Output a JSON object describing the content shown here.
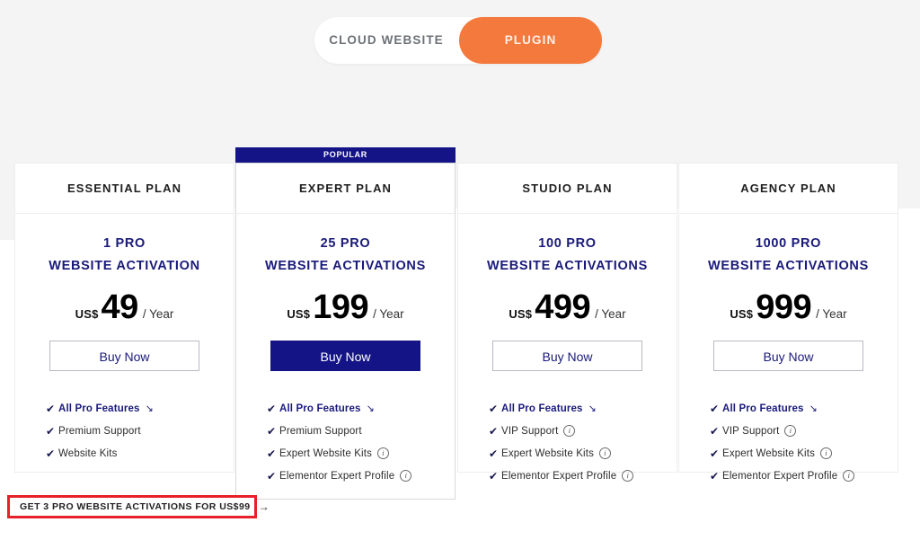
{
  "toggle": {
    "options": [
      {
        "label": "CLOUD WEBSITE",
        "active": false
      },
      {
        "label": "PLUGIN",
        "active": true
      }
    ],
    "active_color": "#f4793d",
    "inactive_text_color": "#6d7278"
  },
  "popular_badge": "POPULAR",
  "accent_navy": "#141487",
  "plans": [
    {
      "name": "ESSENTIAL PLAN",
      "popular": false,
      "activation_count": "1 PRO",
      "activation_label": "WEBSITE ACTIVATION",
      "currency": "US$",
      "amount": "49",
      "period": "/ Year",
      "cta": "Buy Now",
      "cta_style": "outline",
      "features": [
        {
          "label": "All Pro Features",
          "highlight": true,
          "trailing": "arrow-down-right"
        },
        {
          "label": "Premium Support",
          "highlight": false,
          "trailing": "none"
        },
        {
          "label": "Website Kits",
          "highlight": false,
          "trailing": "none"
        }
      ]
    },
    {
      "name": "EXPERT PLAN",
      "popular": true,
      "activation_count": "25 PRO",
      "activation_label": "WEBSITE ACTIVATIONS",
      "currency": "US$",
      "amount": "199",
      "period": "/ Year",
      "cta": "Buy Now",
      "cta_style": "filled",
      "features": [
        {
          "label": "All Pro Features",
          "highlight": true,
          "trailing": "arrow-down-right"
        },
        {
          "label": "Premium Support",
          "highlight": false,
          "trailing": "none"
        },
        {
          "label": "Expert Website Kits",
          "highlight": false,
          "trailing": "info"
        },
        {
          "label": "Elementor Expert Profile",
          "highlight": false,
          "trailing": "info"
        }
      ]
    },
    {
      "name": "STUDIO PLAN",
      "popular": false,
      "activation_count": "100 PRO",
      "activation_label": "WEBSITE ACTIVATIONS",
      "currency": "US$",
      "amount": "499",
      "period": "/ Year",
      "cta": "Buy Now",
      "cta_style": "outline",
      "features": [
        {
          "label": "All Pro Features",
          "highlight": true,
          "trailing": "arrow-down-right"
        },
        {
          "label": "VIP Support",
          "highlight": false,
          "trailing": "info"
        },
        {
          "label": "Expert Website Kits",
          "highlight": false,
          "trailing": "info"
        },
        {
          "label": "Elementor Expert Profile",
          "highlight": false,
          "trailing": "info"
        }
      ]
    },
    {
      "name": "AGENCY PLAN",
      "popular": false,
      "activation_count": "1000 PRO",
      "activation_label": "WEBSITE ACTIVATIONS",
      "currency": "US$",
      "amount": "999",
      "period": "/ Year",
      "cta": "Buy Now",
      "cta_style": "outline",
      "features": [
        {
          "label": "All Pro Features",
          "highlight": true,
          "trailing": "arrow-down-right"
        },
        {
          "label": "VIP Support",
          "highlight": false,
          "trailing": "info"
        },
        {
          "label": "Expert Website Kits",
          "highlight": false,
          "trailing": "info"
        },
        {
          "label": "Elementor Expert Profile",
          "highlight": false,
          "trailing": "info"
        }
      ]
    }
  ],
  "promo": {
    "text": "GET 3 PRO WEBSITE ACTIVATIONS FOR US$99",
    "arrow": "→",
    "highlight_color": "#e8202a"
  },
  "glyphs": {
    "check": "✔",
    "arrow_down_right": "↘",
    "info": "i"
  }
}
